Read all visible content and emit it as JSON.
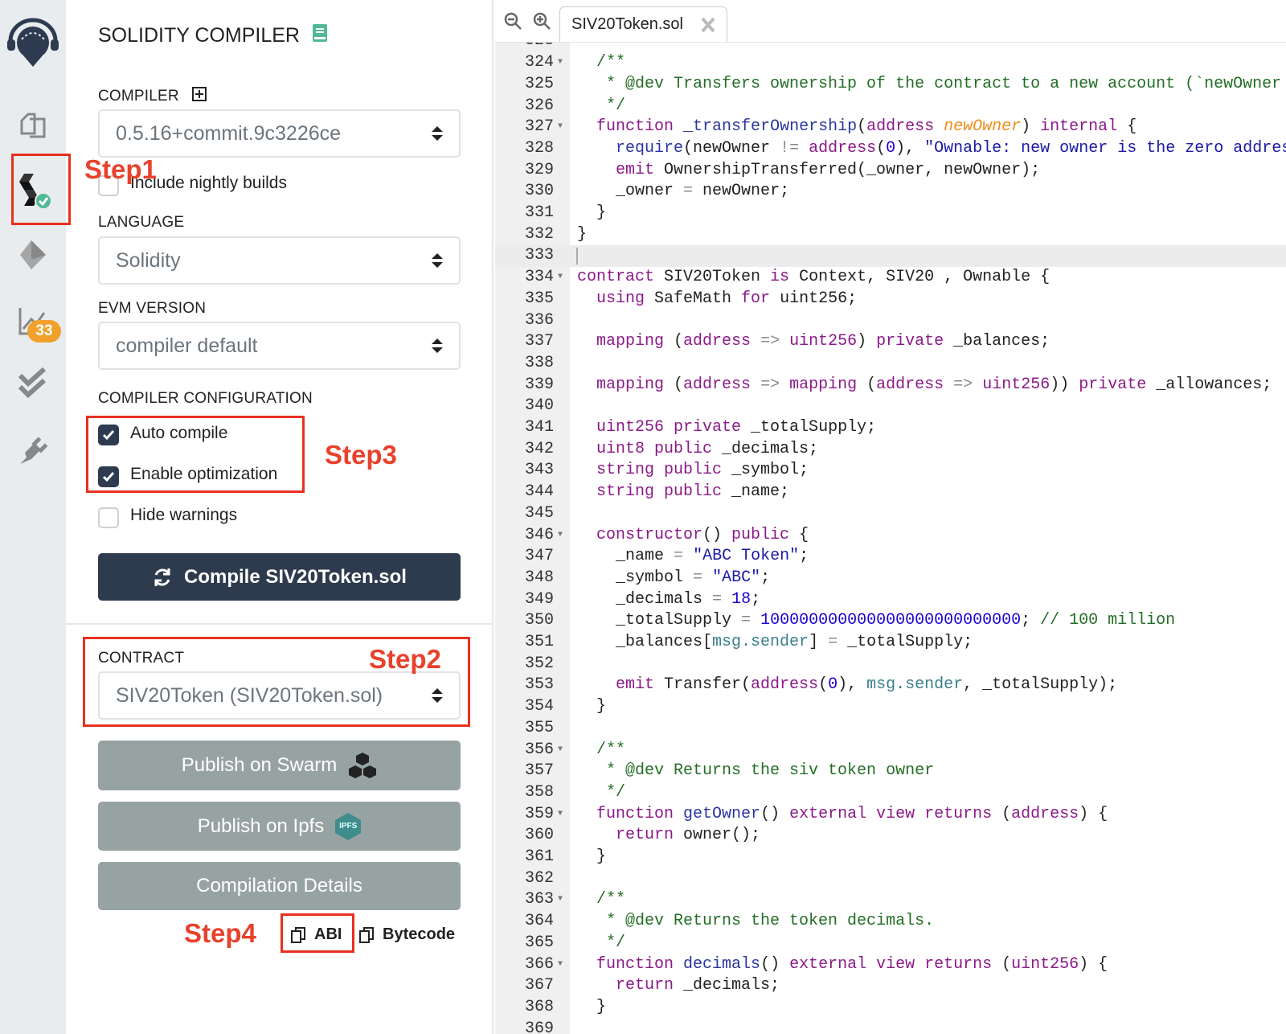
{
  "sidebar": {
    "badge_count": "33",
    "icons": [
      "remix-logo-icon",
      "file-explorer-icon",
      "solidity-compiler-icon",
      "deploy-run-icon",
      "analysis-icon",
      "unit-testing-icon",
      "plugin-manager-icon"
    ]
  },
  "panel": {
    "title": "SOLIDITY COMPILER",
    "compiler_label": "COMPILER",
    "compiler_value": "0.5.16+commit.9c3226ce",
    "nightly_label": "Include nightly builds",
    "nightly_checked": false,
    "language_label": "LANGUAGE",
    "language_value": "Solidity",
    "evm_label": "EVM VERSION",
    "evm_value": "compiler default",
    "config_label": "COMPILER CONFIGURATION",
    "auto_compile_label": "Auto compile",
    "auto_compile_checked": true,
    "optimization_label": "Enable optimization",
    "optimization_checked": true,
    "hide_warnings_label": "Hide warnings",
    "hide_warnings_checked": false,
    "compile_button": "Compile SIV20Token.sol",
    "contract_label": "CONTRACT",
    "contract_value": "SIV20Token (SIV20Token.sol)",
    "swarm_button": "Publish on Swarm",
    "ipfs_button": "Publish on Ipfs",
    "ipfs_badge": "IPFS",
    "details_button": "Compilation Details",
    "abi_label": "ABI",
    "bytecode_label": "Bytecode"
  },
  "annotations": {
    "step1": "Step1",
    "step2": "Step2",
    "step3": "Step3",
    "step4": "Step4",
    "color": "#e8412c"
  },
  "editor": {
    "tab_label": "SIV20Token.sol",
    "highlighted_line": 333,
    "lines": [
      {
        "n": "323",
        "t": []
      },
      {
        "n": "324",
        "fold": true,
        "t": [
          [
            "c",
            "  /**"
          ]
        ]
      },
      {
        "n": "325",
        "t": [
          [
            "c",
            "   * @dev Transfers ownership of the contract to a new account (`newOwner"
          ]
        ]
      },
      {
        "n": "326",
        "t": [
          [
            "c",
            "   */"
          ]
        ]
      },
      {
        "n": "327",
        "fold": true,
        "t": [
          [
            "k",
            "  function"
          ],
          [
            "t",
            " "
          ],
          [
            "f",
            "_transferOwnership"
          ],
          [
            "t",
            "("
          ],
          [
            "k",
            "address"
          ],
          [
            "t",
            " "
          ],
          [
            "p",
            "newOwner"
          ],
          [
            "t",
            ") "
          ],
          [
            "k",
            "internal"
          ],
          [
            "t",
            " {"
          ]
        ]
      },
      {
        "n": "328",
        "t": [
          [
            "t",
            "    "
          ],
          [
            "f",
            "require"
          ],
          [
            "t",
            "(newOwner "
          ],
          [
            "o",
            "!="
          ],
          [
            "t",
            " "
          ],
          [
            "k",
            "address"
          ],
          [
            "t",
            "("
          ],
          [
            "n",
            "0"
          ],
          [
            "t",
            "), "
          ],
          [
            "s",
            "\"Ownable: new owner is the zero addres"
          ]
        ]
      },
      {
        "n": "329",
        "t": [
          [
            "k",
            "    emit"
          ],
          [
            "t",
            " OwnershipTransferred(_owner, newOwner);"
          ]
        ]
      },
      {
        "n": "330",
        "t": [
          [
            "t",
            "    _owner "
          ],
          [
            "o",
            "="
          ],
          [
            "t",
            " newOwner;"
          ]
        ]
      },
      {
        "n": "331",
        "t": [
          [
            "t",
            "  }"
          ]
        ]
      },
      {
        "n": "332",
        "t": [
          [
            "t",
            "}"
          ]
        ]
      },
      {
        "n": "333",
        "t": []
      },
      {
        "n": "334",
        "fold": true,
        "t": [
          [
            "k",
            "contract"
          ],
          [
            "t",
            " SIV20Token "
          ],
          [
            "k",
            "is"
          ],
          [
            "t",
            " Context, SIV20 , Ownable {"
          ]
        ]
      },
      {
        "n": "335",
        "t": [
          [
            "k",
            "  using"
          ],
          [
            "t",
            " SafeMath "
          ],
          [
            "k",
            "for"
          ],
          [
            "t",
            " uint256;"
          ]
        ]
      },
      {
        "n": "336",
        "t": []
      },
      {
        "n": "337",
        "t": [
          [
            "k",
            "  mapping"
          ],
          [
            "t",
            " ("
          ],
          [
            "k",
            "address"
          ],
          [
            "t",
            " "
          ],
          [
            "o",
            "=>"
          ],
          [
            "t",
            " "
          ],
          [
            "k",
            "uint256"
          ],
          [
            "t",
            ") "
          ],
          [
            "k",
            "private"
          ],
          [
            "t",
            " _balances;"
          ]
        ]
      },
      {
        "n": "338",
        "t": []
      },
      {
        "n": "339",
        "t": [
          [
            "k",
            "  mapping"
          ],
          [
            "t",
            " ("
          ],
          [
            "k",
            "address"
          ],
          [
            "t",
            " "
          ],
          [
            "o",
            "=>"
          ],
          [
            "t",
            " "
          ],
          [
            "k",
            "mapping"
          ],
          [
            "t",
            " ("
          ],
          [
            "k",
            "address"
          ],
          [
            "t",
            " "
          ],
          [
            "o",
            "=>"
          ],
          [
            "t",
            " "
          ],
          [
            "k",
            "uint256"
          ],
          [
            "t",
            ")) "
          ],
          [
            "k",
            "private"
          ],
          [
            "t",
            " _allowances;"
          ]
        ]
      },
      {
        "n": "340",
        "t": []
      },
      {
        "n": "341",
        "t": [
          [
            "k",
            "  uint256 private"
          ],
          [
            "t",
            " _totalSupply;"
          ]
        ]
      },
      {
        "n": "342",
        "t": [
          [
            "k",
            "  uint8 public"
          ],
          [
            "t",
            " _decimals;"
          ]
        ]
      },
      {
        "n": "343",
        "t": [
          [
            "k",
            "  string public"
          ],
          [
            "t",
            " _symbol;"
          ]
        ]
      },
      {
        "n": "344",
        "t": [
          [
            "k",
            "  string public"
          ],
          [
            "t",
            " _name;"
          ]
        ]
      },
      {
        "n": "345",
        "t": []
      },
      {
        "n": "346",
        "fold": true,
        "t": [
          [
            "k",
            "  constructor"
          ],
          [
            "t",
            "() "
          ],
          [
            "k",
            "public"
          ],
          [
            "t",
            " {"
          ]
        ]
      },
      {
        "n": "347",
        "t": [
          [
            "t",
            "    _name "
          ],
          [
            "o",
            "="
          ],
          [
            "t",
            " "
          ],
          [
            "s",
            "\"ABC Token\""
          ],
          [
            "t",
            ";"
          ]
        ]
      },
      {
        "n": "348",
        "t": [
          [
            "t",
            "    _symbol "
          ],
          [
            "o",
            "="
          ],
          [
            "t",
            " "
          ],
          [
            "s",
            "\"ABC\""
          ],
          [
            "t",
            ";"
          ]
        ]
      },
      {
        "n": "349",
        "t": [
          [
            "t",
            "    _decimals "
          ],
          [
            "o",
            "="
          ],
          [
            "t",
            " "
          ],
          [
            "n",
            "18"
          ],
          [
            "t",
            ";"
          ]
        ]
      },
      {
        "n": "350",
        "t": [
          [
            "t",
            "    _totalSupply "
          ],
          [
            "o",
            "="
          ],
          [
            "t",
            " "
          ],
          [
            "n",
            "100000000000000000000000000"
          ],
          [
            "t",
            "; "
          ],
          [
            "c",
            "// 100 million"
          ]
        ]
      },
      {
        "n": "351",
        "t": [
          [
            "t",
            "    _balances["
          ],
          [
            "v",
            "msg.sender"
          ],
          [
            "t",
            "] "
          ],
          [
            "o",
            "="
          ],
          [
            "t",
            " _totalSupply;"
          ]
        ]
      },
      {
        "n": "352",
        "t": []
      },
      {
        "n": "353",
        "t": [
          [
            "k",
            "    emit"
          ],
          [
            "t",
            " Transfer("
          ],
          [
            "k",
            "address"
          ],
          [
            "t",
            "("
          ],
          [
            "n",
            "0"
          ],
          [
            "t",
            "), "
          ],
          [
            "v",
            "msg.sender"
          ],
          [
            "t",
            ", _totalSupply);"
          ]
        ]
      },
      {
        "n": "354",
        "t": [
          [
            "t",
            "  }"
          ]
        ]
      },
      {
        "n": "355",
        "t": []
      },
      {
        "n": "356",
        "fold": true,
        "t": [
          [
            "c",
            "  /**"
          ]
        ]
      },
      {
        "n": "357",
        "t": [
          [
            "c",
            "   * @dev Returns the siv token owner"
          ]
        ]
      },
      {
        "n": "358",
        "t": [
          [
            "c",
            "   */"
          ]
        ]
      },
      {
        "n": "359",
        "fold": true,
        "t": [
          [
            "k",
            "  function"
          ],
          [
            "t",
            " "
          ],
          [
            "f",
            "getOwner"
          ],
          [
            "t",
            "() "
          ],
          [
            "k",
            "external view returns"
          ],
          [
            "t",
            " ("
          ],
          [
            "k",
            "address"
          ],
          [
            "t",
            ") {"
          ]
        ]
      },
      {
        "n": "360",
        "t": [
          [
            "k",
            "    return"
          ],
          [
            "t",
            " owner();"
          ]
        ]
      },
      {
        "n": "361",
        "t": [
          [
            "t",
            "  }"
          ]
        ]
      },
      {
        "n": "362",
        "t": []
      },
      {
        "n": "363",
        "fold": true,
        "t": [
          [
            "c",
            "  /**"
          ]
        ]
      },
      {
        "n": "364",
        "t": [
          [
            "c",
            "   * @dev Returns the token decimals."
          ]
        ]
      },
      {
        "n": "365",
        "t": [
          [
            "c",
            "   */"
          ]
        ]
      },
      {
        "n": "366",
        "fold": true,
        "t": [
          [
            "k",
            "  function"
          ],
          [
            "t",
            " "
          ],
          [
            "f",
            "decimals"
          ],
          [
            "t",
            "() "
          ],
          [
            "k",
            "external view returns"
          ],
          [
            "t",
            " ("
          ],
          [
            "k",
            "uint256"
          ],
          [
            "t",
            ") {"
          ]
        ]
      },
      {
        "n": "367",
        "t": [
          [
            "k",
            "    return"
          ],
          [
            "t",
            " _decimals;"
          ]
        ]
      },
      {
        "n": "368",
        "t": [
          [
            "t",
            "  }"
          ]
        ]
      },
      {
        "n": "369",
        "t": []
      }
    ]
  }
}
